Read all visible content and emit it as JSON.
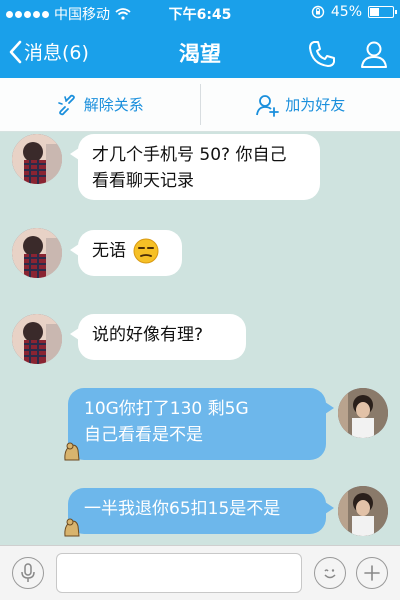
{
  "status_bar": {
    "carrier": "中国移动",
    "time": "下午6:45",
    "battery": "45%",
    "battery_level": 0.45
  },
  "nav": {
    "back_label": "消息(6)",
    "title": "渴望",
    "phone_icon": "phone-icon",
    "profile_icon": "person-icon"
  },
  "actions": {
    "unlink_label": "解除关系",
    "add_friend_label": "加为好友"
  },
  "messages": [
    {
      "direction": "in",
      "lines": [
        "才几个手机号 50?  你自己",
        "看看聊天记录"
      ]
    },
    {
      "direction": "in",
      "text": "无语",
      "emoji": "unamused-face"
    },
    {
      "direction": "in",
      "text": "说的好像有理?"
    },
    {
      "direction": "out",
      "lines": [
        "10G你打了130      剩5G",
        "自己看看是不是"
      ]
    },
    {
      "direction": "out",
      "text": "一半我退你65扣15是不是"
    }
  ],
  "input": {
    "placeholder": "",
    "value": ""
  },
  "colors": {
    "nav_blue": "#1aa0ea",
    "chat_bg": "#cfe3df",
    "outgoing_bubble": "#6db7eb",
    "action_text": "#1a8fdc"
  }
}
